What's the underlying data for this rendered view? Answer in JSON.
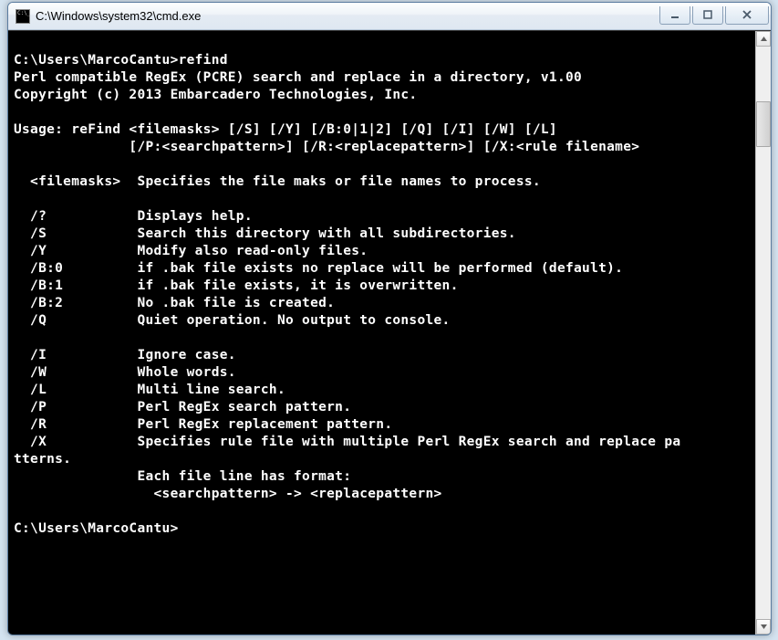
{
  "window": {
    "title": "C:\\Windows\\system32\\cmd.exe"
  },
  "console": {
    "lines": [
      "",
      "C:\\Users\\MarcoCantu>refind",
      "Perl compatible RegEx (PCRE) search and replace in a directory, v1.00",
      "Copyright (c) 2013 Embarcadero Technologies, Inc.",
      "",
      "Usage: reFind <filemasks> [/S] [/Y] [/B:0|1|2] [/Q] [/I] [/W] [/L]",
      "              [/P:<searchpattern>] [/R:<replacepattern>] [/X:<rule filename>",
      "",
      "  <filemasks>  Specifies the file maks or file names to process.",
      "",
      "  /?           Displays help.",
      "  /S           Search this directory with all subdirectories.",
      "  /Y           Modify also read-only files.",
      "  /B:0         if .bak file exists no replace will be performed (default).",
      "  /B:1         if .bak file exists, it is overwritten.",
      "  /B:2         No .bak file is created.",
      "  /Q           Quiet operation. No output to console.",
      "",
      "  /I           Ignore case.",
      "  /W           Whole words.",
      "  /L           Multi line search.",
      "  /P           Perl RegEx search pattern.",
      "  /R           Perl RegEx replacement pattern.",
      "  /X           Specifies rule file with multiple Perl RegEx search and replace pa",
      "tterns.",
      "               Each file line has format:",
      "                 <searchpattern> -> <replacepattern>",
      "",
      "C:\\Users\\MarcoCantu>"
    ]
  }
}
